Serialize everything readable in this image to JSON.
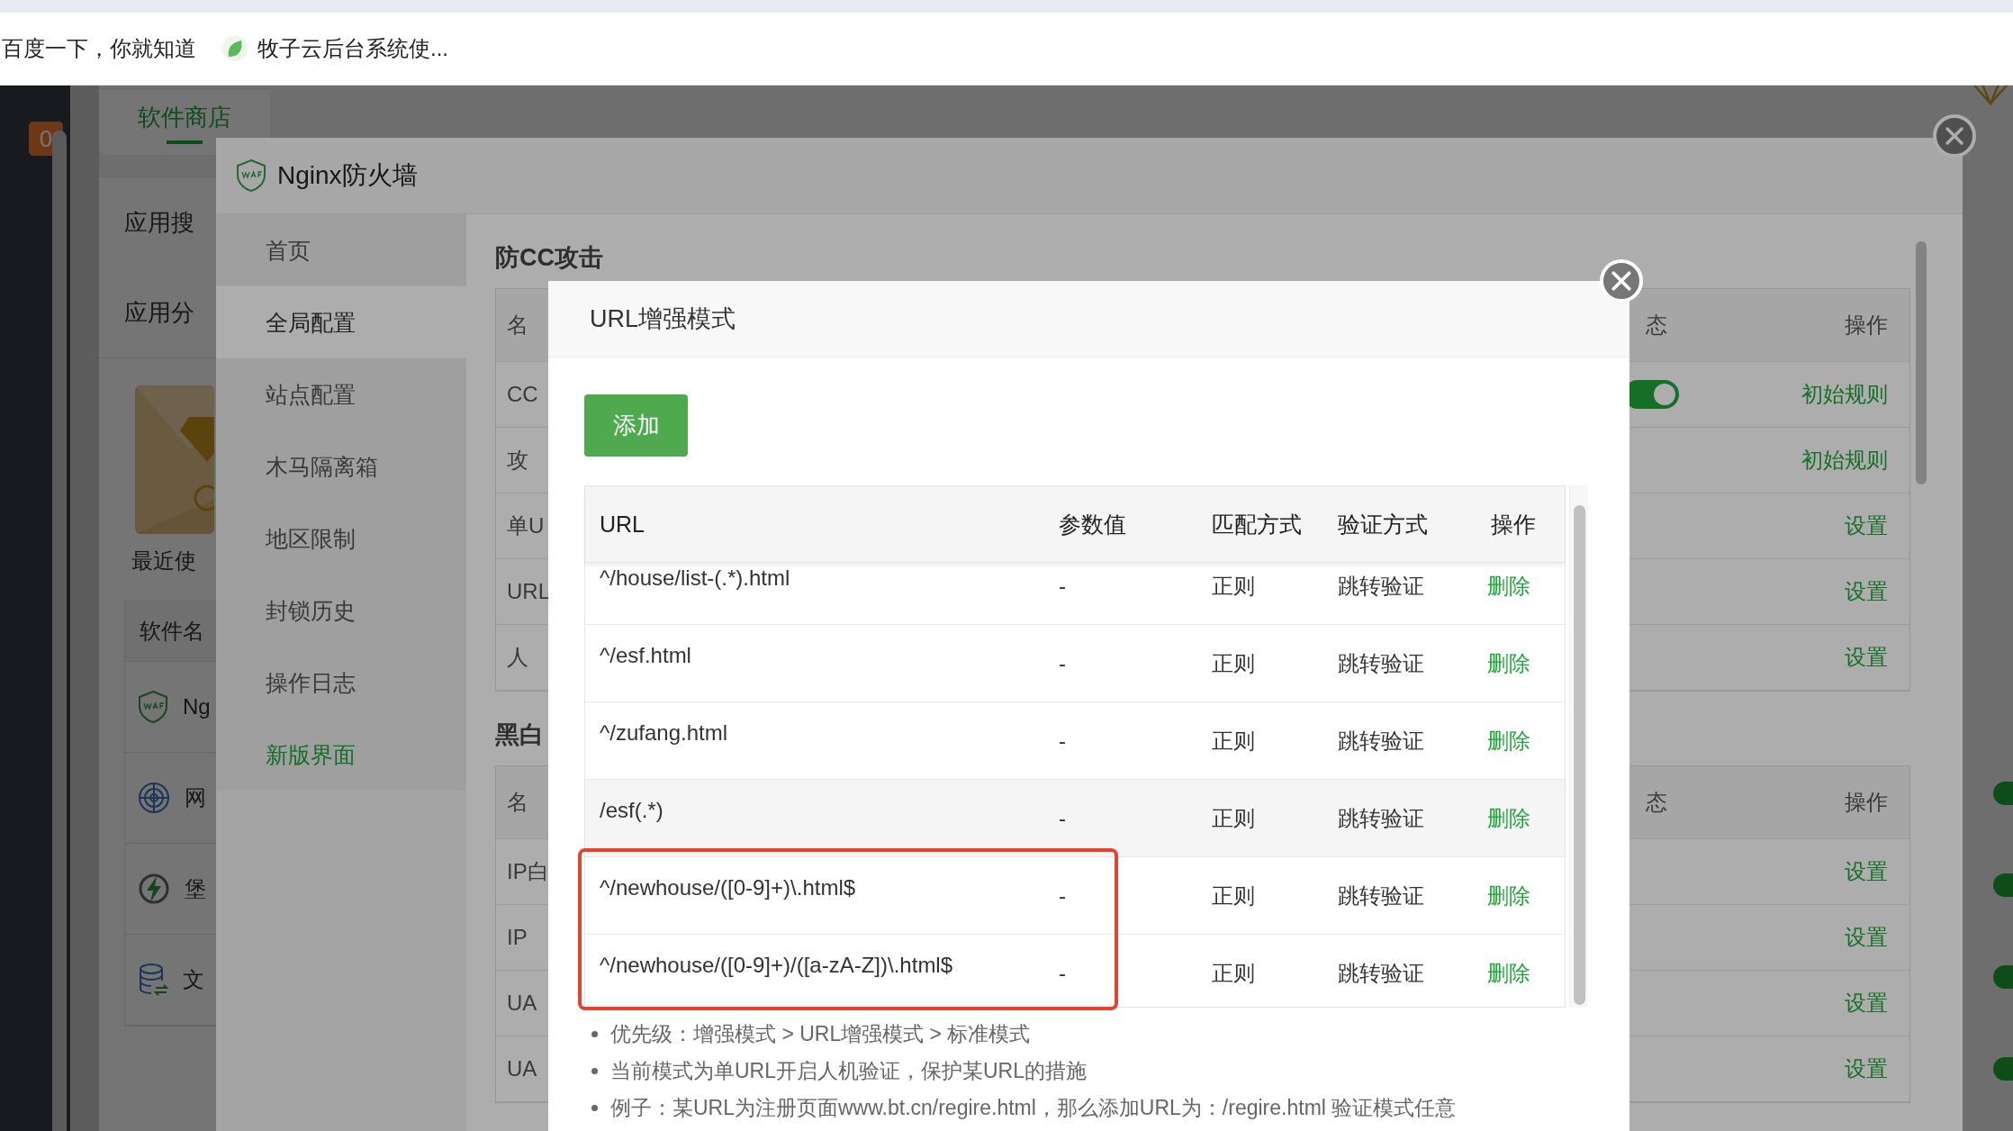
{
  "bookmarks": [
    {
      "kind": "plain",
      "label": "百度一下，你就知道"
    },
    {
      "kind": "leaf",
      "label": "牧子云后台系统使..."
    }
  ],
  "sidebar": {
    "badge": "0"
  },
  "store": {
    "tab": "软件商店",
    "search_label": "应用搜",
    "category_label": "应用分",
    "recent_label": "最近使",
    "table_header": "软件名",
    "rows": [
      {
        "kind": "waf",
        "name": "Ng"
      },
      {
        "kind": "radar",
        "name": "网"
      },
      {
        "kind": "bolt",
        "name": "堡"
      },
      {
        "kind": "db",
        "name": "文"
      }
    ],
    "right_toggles": [
      {
        "on": true
      },
      {
        "on": true
      },
      {
        "on": true
      },
      {
        "on": true
      }
    ]
  },
  "firewall": {
    "title": "Nginx防火墙",
    "menu": [
      {
        "label": "首页",
        "kind": "item",
        "selected": false
      },
      {
        "label": "全局配置",
        "kind": "item",
        "selected": true
      },
      {
        "label": "站点配置",
        "kind": "item",
        "selected": false
      },
      {
        "label": "木马隔离箱",
        "kind": "item",
        "selected": false
      },
      {
        "label": "地区限制",
        "kind": "item",
        "selected": false
      },
      {
        "label": "封锁历史",
        "kind": "item",
        "selected": false
      },
      {
        "label": "操作日志",
        "kind": "item",
        "selected": false
      },
      {
        "label": "新版界面",
        "kind": "link",
        "selected": false
      }
    ],
    "sections": [
      {
        "title": "防CC攻击",
        "header": {
          "name": "名",
          "status": "态",
          "action": "操作"
        },
        "rows": [
          {
            "name": "CC",
            "toggle": true,
            "action": "初始规则"
          },
          {
            "name": "攻",
            "action": "初始规则"
          },
          {
            "name": "单U",
            "action": "设置"
          },
          {
            "name": "URL",
            "action": "设置"
          },
          {
            "name": "人",
            "action": "设置"
          }
        ]
      },
      {
        "title": "黑白",
        "header": {
          "name": "名",
          "status": "态",
          "action": "操作"
        },
        "rows": [
          {
            "name": "IP白",
            "action": "设置"
          },
          {
            "name": "IP",
            "action": "设置"
          },
          {
            "name": "UA",
            "action": "设置"
          },
          {
            "name": "UA",
            "action": "设置"
          }
        ]
      }
    ]
  },
  "modal": {
    "title": "URL增强模式",
    "add_button": "添加",
    "columns": [
      "URL",
      "参数值",
      "匹配方式",
      "验证方式",
      "操作"
    ],
    "rows": [
      {
        "url": "^/house/list-(.*).html",
        "param": "-",
        "match": "正则",
        "verify": "跳转验证",
        "action": "删除",
        "hovered": false,
        "highlighted": false
      },
      {
        "url": "^/esf.html",
        "param": "-",
        "match": "正则",
        "verify": "跳转验证",
        "action": "删除",
        "hovered": false,
        "highlighted": false
      },
      {
        "url": "^/zufang.html",
        "param": "-",
        "match": "正则",
        "verify": "跳转验证",
        "action": "删除",
        "hovered": false,
        "highlighted": false
      },
      {
        "url": "/esf(.*)",
        "param": "-",
        "match": "正则",
        "verify": "跳转验证",
        "action": "删除",
        "hovered": true,
        "highlighted": false
      },
      {
        "url": "^/newhouse/([0-9]+)\\.html$",
        "param": "-",
        "match": "正则",
        "verify": "跳转验证",
        "action": "删除",
        "hovered": false,
        "highlighted": true
      },
      {
        "url": "^/newhouse/([0-9]+)/([a-zA-Z])\\.html$",
        "param": "-",
        "match": "正则",
        "verify": "跳转验证",
        "action": "删除",
        "hovered": false,
        "highlighted": true
      }
    ],
    "notes": [
      "优先级：增强模式 > URL增强模式 > 标准模式",
      "当前模式为单URL开启人机验证，保护某URL的措施",
      "例子：某URL为注册页面www.bt.cn/regire.html，那么添加URL为：/regire.html 验证模式任意"
    ]
  }
}
